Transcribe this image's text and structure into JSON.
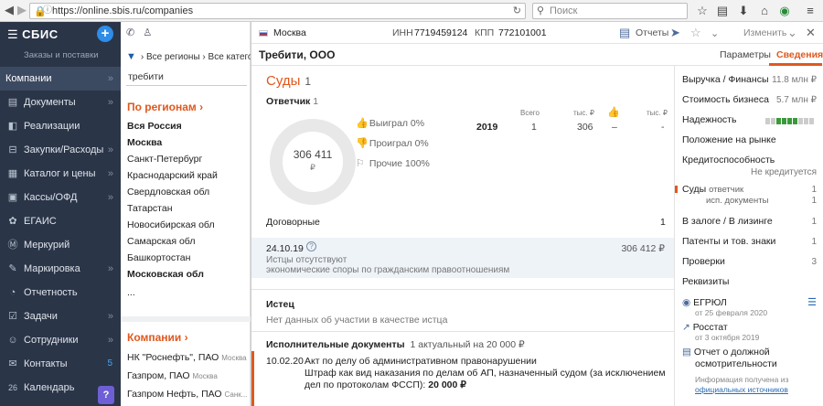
{
  "browser": {
    "url": "https://online.sbis.ru/companies",
    "search_placeholder": "Поиск"
  },
  "sidebar": {
    "app_name": "СБИС",
    "subtitle": "Заказы и поставки",
    "items": [
      {
        "label": "Компании",
        "icon": "building-icon",
        "active": true
      },
      {
        "label": "Документы",
        "icon": "document-icon"
      },
      {
        "label": "Реализации",
        "icon": "sales-icon"
      },
      {
        "label": "Закупки/Расходы",
        "icon": "purchase-icon"
      },
      {
        "label": "Каталог и цены",
        "icon": "catalog-icon"
      },
      {
        "label": "Кассы/ОФД",
        "icon": "cashbox-icon"
      },
      {
        "label": "ЕГАИС",
        "icon": "egais-icon"
      },
      {
        "label": "Меркурий",
        "icon": "mercury-icon"
      },
      {
        "label": "Маркировка",
        "icon": "marking-icon"
      },
      {
        "label": "Отчетность",
        "icon": "report-icon"
      },
      {
        "label": "Задачи",
        "icon": "tasks-icon"
      },
      {
        "label": "Сотрудники",
        "icon": "staff-icon"
      },
      {
        "label": "Контакты",
        "icon": "contacts-icon",
        "count": "5"
      },
      {
        "label": "Календарь",
        "icon": "calendar-icon",
        "day": "26"
      }
    ],
    "help": "?"
  },
  "left_panel": {
    "filter_regions": "Все регионы",
    "filter_categories": "Все категор",
    "search_value": "требити",
    "regions_title": "По регионам",
    "regions": [
      {
        "name": "Вся Россия",
        "bold": true
      },
      {
        "name": "Москва",
        "bold": true
      },
      {
        "name": "Санкт-Петербург"
      },
      {
        "name": "Краснодарский край"
      },
      {
        "name": "Свердловская обл"
      },
      {
        "name": "Татарстан"
      },
      {
        "name": "Новосибирская обл"
      },
      {
        "name": "Самарская обл"
      },
      {
        "name": "Башкортостан"
      },
      {
        "name": "Московская обл",
        "bold": true
      },
      {
        "name": "..."
      }
    ],
    "companies_title": "Компании",
    "companies": [
      {
        "name": "НК \"Роснефть\", ПАО",
        "city": "Москва"
      },
      {
        "name": "Газпром, ПАО",
        "city": "Москва"
      },
      {
        "name": "Газпром Нефть, ПАО",
        "city": "Санк..."
      }
    ]
  },
  "card": {
    "city": "Москва",
    "inn_label": "ИНН",
    "inn": "7719459124",
    "kpp_label": "КПП",
    "kpp": "772101001",
    "reports_label": "Отчеты",
    "edit_label": "Изменить",
    "company_name": "Требити, ООО",
    "tab_params": "Параметры",
    "tab_info": "Сведения"
  },
  "cases": {
    "title": "Суды",
    "count": "1",
    "respondent_label": "Ответчик",
    "respondent_count": "1",
    "donut_value": "306 411",
    "donut_currency": "₽",
    "won": "Выиграл 0%",
    "lost": "Проиграл 0%",
    "other": "Прочие 100%",
    "grid_head_total": "Всего",
    "grid_head_thous1": "тыс. ₽",
    "grid_head_thous2": "тыс. ₽",
    "year": "2019",
    "total": "1",
    "amount": "306",
    "dash1": "–",
    "dash2": "-",
    "contract_label": "Договорные",
    "contract_count": "1",
    "case_date": "24.10.19",
    "case_sum": "306 412 ₽",
    "case_plaintiffs": "Истцы отсутствуют",
    "case_category": "экономические споры по гражданским правоотношениям",
    "plaintiff_label": "Истец",
    "plaintiff_value": "Нет данных об участии в качестве истца",
    "exec_label": "Исполнительные документы",
    "exec_summary": "1 актуальный на 20 000 ₽",
    "exec_date": "10.02.20",
    "exec_line1": "Акт по делу об административном правонарушении",
    "exec_line2": "Штраф как вид наказания по делам об АП, назначенный судом (за исключением дел по протоколам ФССП):",
    "exec_amount": "20 000 ₽"
  },
  "info_panel": {
    "revenue_label": "Выручка / Финансы",
    "revenue_value": "11.8 млн ₽",
    "business_value_label": "Стоимость бизнеса",
    "business_value": "5.7 млн ₽",
    "reliability_label": "Надежность",
    "market_label": "Положение на рынке",
    "credit_label": "Кредитоспособность",
    "credit_value": "Не кредитуется",
    "courts_label": "Суды",
    "courts_sub1": "ответчик",
    "courts_sub1_val": "1",
    "courts_sub2": "исп. документы",
    "courts_sub2_val": "1",
    "pledge_label": "В залоге / В лизинге",
    "pledge_value": "1",
    "patents_label": "Патенты и тов. знаки",
    "patents_value": "1",
    "checks_label": "Проверки",
    "checks_value": "3",
    "requisites_label": "Реквизиты",
    "egrul_label": "ЕГРЮЛ",
    "egrul_date": "от 25 февраля 2020",
    "rosstat_label": "Росстат",
    "rosstat_date": "от 3 октября 2019",
    "diligence_line1": "Отчет о должной",
    "diligence_line2": "осмотрительности",
    "source_note": "Информация получена из",
    "source_link": "официальных источников"
  }
}
